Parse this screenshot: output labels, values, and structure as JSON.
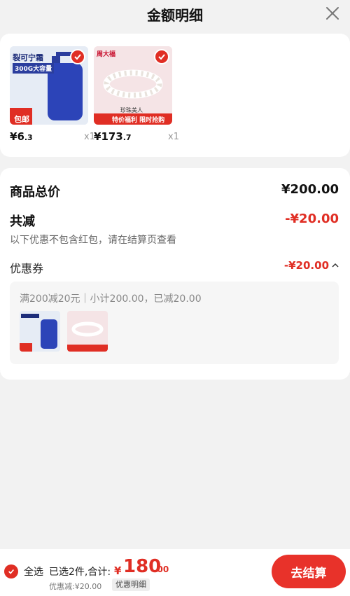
{
  "header": {
    "title": "金额明细"
  },
  "products": [
    {
      "image_texts": [
        "裂可宁霜",
        "300G大容量",
        "包邮"
      ],
      "price_int": "6",
      "price_dec": ".3",
      "currency": "¥",
      "qty": "x1"
    },
    {
      "image_texts": [
        "周大福",
        "珍珠美人",
        "特价福利 限时抢购"
      ],
      "price_int": "173",
      "price_dec": ".7",
      "currency": "¥",
      "qty": "x1"
    }
  ],
  "summary": {
    "total_label": "商品总价",
    "total_value": "¥200.00",
    "reduction_label": "共减",
    "reduction_value": "-¥20.00",
    "note": "以下优惠不包含红包，请在结算页查看",
    "coupon_label": "优惠券",
    "coupon_value": "-¥20.00",
    "coupon_desc": "满200减20元｜小计200.00，已减20.00"
  },
  "bottom": {
    "select_all": "全选",
    "selected_text": "已选2件,合计:",
    "currency": "¥",
    "total_int": "180",
    "total_dec": ".00",
    "discount_text": "优惠减:¥20.00",
    "detail_tag": "优惠明细",
    "checkout": "去结算"
  },
  "colors": {
    "accent": "#e02e24",
    "bg": "#f2f2f2"
  }
}
